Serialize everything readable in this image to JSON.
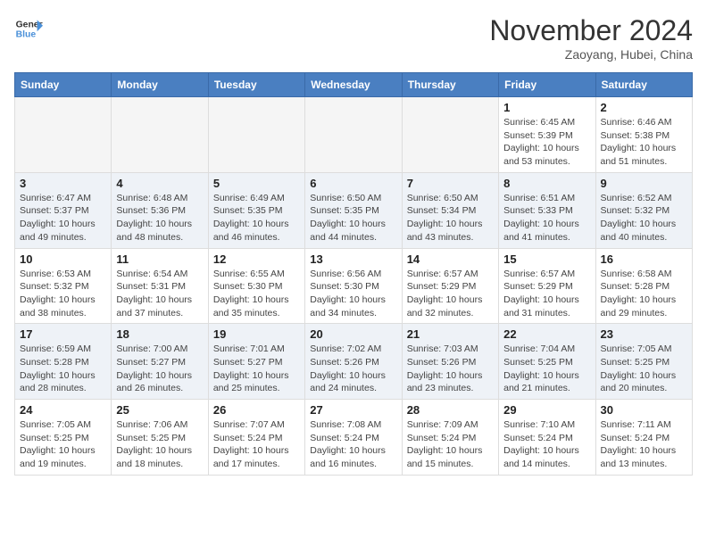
{
  "header": {
    "logo_line1": "General",
    "logo_line2": "Blue",
    "month": "November 2024",
    "location": "Zaoyang, Hubei, China"
  },
  "days_of_week": [
    "Sunday",
    "Monday",
    "Tuesday",
    "Wednesday",
    "Thursday",
    "Friday",
    "Saturday"
  ],
  "weeks": [
    [
      {
        "day": "",
        "empty": true
      },
      {
        "day": "",
        "empty": true
      },
      {
        "day": "",
        "empty": true
      },
      {
        "day": "",
        "empty": true
      },
      {
        "day": "",
        "empty": true
      },
      {
        "day": "1",
        "sunrise": "6:45 AM",
        "sunset": "5:39 PM",
        "daylight": "10 hours and 53 minutes."
      },
      {
        "day": "2",
        "sunrise": "6:46 AM",
        "sunset": "5:38 PM",
        "daylight": "10 hours and 51 minutes."
      }
    ],
    [
      {
        "day": "3",
        "sunrise": "6:47 AM",
        "sunset": "5:37 PM",
        "daylight": "10 hours and 49 minutes."
      },
      {
        "day": "4",
        "sunrise": "6:48 AM",
        "sunset": "5:36 PM",
        "daylight": "10 hours and 48 minutes."
      },
      {
        "day": "5",
        "sunrise": "6:49 AM",
        "sunset": "5:35 PM",
        "daylight": "10 hours and 46 minutes."
      },
      {
        "day": "6",
        "sunrise": "6:50 AM",
        "sunset": "5:35 PM",
        "daylight": "10 hours and 44 minutes."
      },
      {
        "day": "7",
        "sunrise": "6:50 AM",
        "sunset": "5:34 PM",
        "daylight": "10 hours and 43 minutes."
      },
      {
        "day": "8",
        "sunrise": "6:51 AM",
        "sunset": "5:33 PM",
        "daylight": "10 hours and 41 minutes."
      },
      {
        "day": "9",
        "sunrise": "6:52 AM",
        "sunset": "5:32 PM",
        "daylight": "10 hours and 40 minutes."
      }
    ],
    [
      {
        "day": "10",
        "sunrise": "6:53 AM",
        "sunset": "5:32 PM",
        "daylight": "10 hours and 38 minutes."
      },
      {
        "day": "11",
        "sunrise": "6:54 AM",
        "sunset": "5:31 PM",
        "daylight": "10 hours and 37 minutes."
      },
      {
        "day": "12",
        "sunrise": "6:55 AM",
        "sunset": "5:30 PM",
        "daylight": "10 hours and 35 minutes."
      },
      {
        "day": "13",
        "sunrise": "6:56 AM",
        "sunset": "5:30 PM",
        "daylight": "10 hours and 34 minutes."
      },
      {
        "day": "14",
        "sunrise": "6:57 AM",
        "sunset": "5:29 PM",
        "daylight": "10 hours and 32 minutes."
      },
      {
        "day": "15",
        "sunrise": "6:57 AM",
        "sunset": "5:29 PM",
        "daylight": "10 hours and 31 minutes."
      },
      {
        "day": "16",
        "sunrise": "6:58 AM",
        "sunset": "5:28 PM",
        "daylight": "10 hours and 29 minutes."
      }
    ],
    [
      {
        "day": "17",
        "sunrise": "6:59 AM",
        "sunset": "5:28 PM",
        "daylight": "10 hours and 28 minutes."
      },
      {
        "day": "18",
        "sunrise": "7:00 AM",
        "sunset": "5:27 PM",
        "daylight": "10 hours and 26 minutes."
      },
      {
        "day": "19",
        "sunrise": "7:01 AM",
        "sunset": "5:27 PM",
        "daylight": "10 hours and 25 minutes."
      },
      {
        "day": "20",
        "sunrise": "7:02 AM",
        "sunset": "5:26 PM",
        "daylight": "10 hours and 24 minutes."
      },
      {
        "day": "21",
        "sunrise": "7:03 AM",
        "sunset": "5:26 PM",
        "daylight": "10 hours and 23 minutes."
      },
      {
        "day": "22",
        "sunrise": "7:04 AM",
        "sunset": "5:25 PM",
        "daylight": "10 hours and 21 minutes."
      },
      {
        "day": "23",
        "sunrise": "7:05 AM",
        "sunset": "5:25 PM",
        "daylight": "10 hours and 20 minutes."
      }
    ],
    [
      {
        "day": "24",
        "sunrise": "7:05 AM",
        "sunset": "5:25 PM",
        "daylight": "10 hours and 19 minutes."
      },
      {
        "day": "25",
        "sunrise": "7:06 AM",
        "sunset": "5:25 PM",
        "daylight": "10 hours and 18 minutes."
      },
      {
        "day": "26",
        "sunrise": "7:07 AM",
        "sunset": "5:24 PM",
        "daylight": "10 hours and 17 minutes."
      },
      {
        "day": "27",
        "sunrise": "7:08 AM",
        "sunset": "5:24 PM",
        "daylight": "10 hours and 16 minutes."
      },
      {
        "day": "28",
        "sunrise": "7:09 AM",
        "sunset": "5:24 PM",
        "daylight": "10 hours and 15 minutes."
      },
      {
        "day": "29",
        "sunrise": "7:10 AM",
        "sunset": "5:24 PM",
        "daylight": "10 hours and 14 minutes."
      },
      {
        "day": "30",
        "sunrise": "7:11 AM",
        "sunset": "5:24 PM",
        "daylight": "10 hours and 13 minutes."
      }
    ]
  ]
}
